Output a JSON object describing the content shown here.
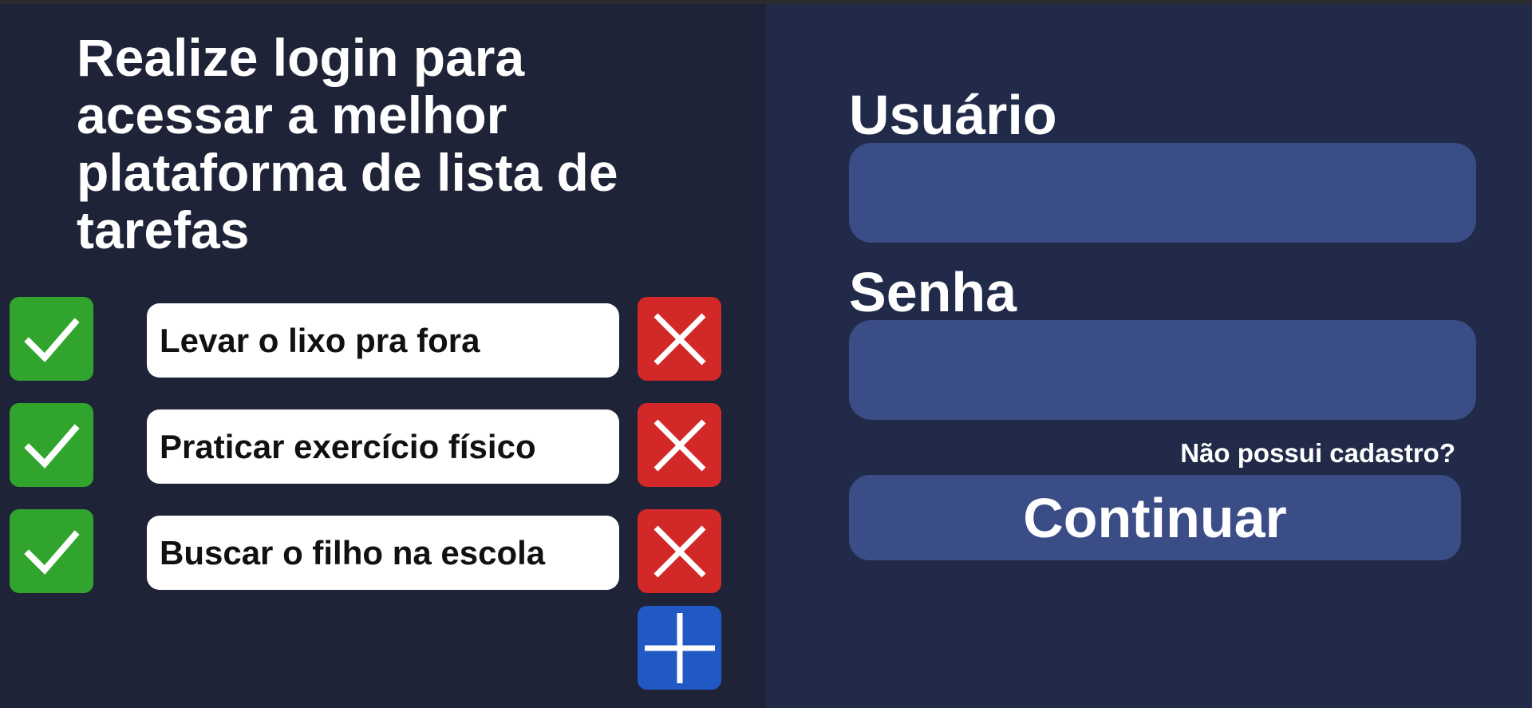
{
  "left": {
    "headline": "Realize login para acessar a melhor plataforma de lista de tarefas",
    "tasks": [
      {
        "text": "Levar o lixo pra fora"
      },
      {
        "text": "Praticar exercício físico"
      },
      {
        "text": "Buscar o filho na escola"
      }
    ],
    "icons": {
      "check": "check-icon",
      "delete": "close-icon",
      "add": "plus-icon"
    }
  },
  "login": {
    "user_label": "Usuário",
    "user_value": "",
    "password_label": "Senha",
    "password_value": "",
    "signup_link": "Não possui cadastro?",
    "continue_label": "Continuar"
  },
  "colors": {
    "left_background": "#1f2337",
    "right_background": "#212a48",
    "check": "#31a42d",
    "delete": "#d32828",
    "add": "#2159c4",
    "input": "#3b4d87"
  }
}
